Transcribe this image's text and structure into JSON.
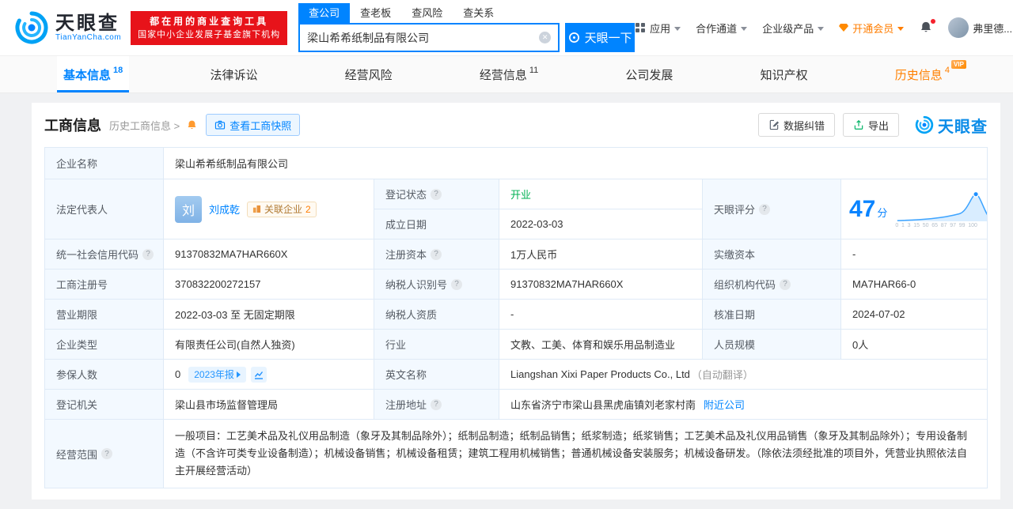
{
  "colors": {
    "brand_blue": "#0084ff",
    "vip_orange": "#ff7d00",
    "status_open_green": "#00b153",
    "banner_red": "#e7131a",
    "label_cell_bg": "#f3f9ff"
  },
  "icons": [
    "tianyancha-logo-icon",
    "clear-search-icon",
    "eye-icon",
    "apps-grid-icon",
    "vip-gem-icon",
    "notification-bell-icon",
    "chevron-down-icon",
    "help-icon",
    "reminder-bell-icon",
    "camera-icon",
    "data-correction-icon",
    "export-icon",
    "watermark-logo-icon",
    "related-company-icon",
    "annual-report-chart-icon",
    "score-distribution-chart"
  ],
  "header": {
    "logo": {
      "brand": "天眼查",
      "domain": "TianYanCha.com"
    },
    "slogan": {
      "line1": "都在用的商业查询工具",
      "line2": "国家中小企业发展子基金旗下机构"
    },
    "search_tabs": [
      {
        "label": "查公司"
      },
      {
        "label": "查老板"
      },
      {
        "label": "查风险"
      },
      {
        "label": "查关系"
      }
    ],
    "search": {
      "value": "梁山希希纸制品有限公司",
      "button_label": "天眼一下"
    },
    "menu": {
      "apps": "应用",
      "cooperation": "合作通道",
      "enterprise": "企业级产品",
      "vip": "开通会员",
      "user": "弗里德..."
    }
  },
  "nav": {
    "tabs": [
      {
        "label": "基本信息",
        "count": "18"
      },
      {
        "label": "法律诉讼"
      },
      {
        "label": "经营风险"
      },
      {
        "label": "经营信息",
        "count": "11"
      },
      {
        "label": "公司发展"
      },
      {
        "label": "知识产权"
      },
      {
        "label": "历史信息",
        "count": "4",
        "tag": "VIP"
      }
    ]
  },
  "toolbar": {
    "title": "工商信息",
    "history_link": "历史工商信息 >",
    "snapshot_button": "查看工商快照",
    "correct_button": "数据纠错",
    "export_button": "导出",
    "watermark": "天眼查"
  },
  "fields": {
    "company_name": {
      "label": "企业名称",
      "value": "梁山希希纸制品有限公司"
    },
    "legal_rep": {
      "label": "法定代表人",
      "avatar_char": "刘",
      "name": "刘成乾",
      "badge_label": "关联企业",
      "badge_count": "2"
    },
    "reg_status": {
      "label": "登记状态",
      "value": "开业"
    },
    "establish_date": {
      "label": "成立日期",
      "value": "2022-03-03"
    },
    "score": {
      "label": "天眼评分",
      "value": "47",
      "unit": "分",
      "ticks": [
        "0",
        "1",
        "3",
        "15",
        "50",
        "65",
        "87",
        "97",
        "99",
        "100"
      ]
    },
    "credit_code": {
      "label": "统一社会信用代码",
      "value": "91370832MA7HAR660X"
    },
    "reg_capital": {
      "label": "注册资本",
      "value": "1万人民币"
    },
    "paid_capital": {
      "label": "实缴资本",
      "value": "-"
    },
    "reg_number": {
      "label": "工商注册号",
      "value": "370832200272157"
    },
    "taxpayer_id": {
      "label": "纳税人识别号",
      "value": "91370832MA7HAR660X"
    },
    "org_code": {
      "label": "组织机构代码",
      "value": "MA7HAR66-0"
    },
    "business_term": {
      "label": "营业期限",
      "value": "2022-03-03 至 无固定期限"
    },
    "taxpayer_quality": {
      "label": "纳税人资质",
      "value": "-"
    },
    "approve_date": {
      "label": "核准日期",
      "value": "2024-07-02"
    },
    "company_type": {
      "label": "企业类型",
      "value": "有限责任公司(自然人独资)"
    },
    "industry": {
      "label": "行业",
      "value": "文教、工美、体育和娱乐用品制造业"
    },
    "staff_size": {
      "label": "人员规模",
      "value": "0人"
    },
    "insured": {
      "label": "参保人数",
      "value": "0",
      "report_badge": "2023年报"
    },
    "english_name": {
      "label": "英文名称",
      "value": "Liangshan Xixi Paper Products Co., Ltd",
      "note": "（自动翻译）"
    },
    "reg_authority": {
      "label": "登记机关",
      "value": "梁山县市场监督管理局"
    },
    "reg_address": {
      "label": "注册地址",
      "value": "山东省济宁市梁山县黑虎庙镇刘老家村南",
      "nearby_link": "附近公司"
    },
    "business_scope": {
      "label": "经营范围",
      "value": "一般项目：工艺美术品及礼仪用品制造（象牙及其制品除外）；纸制品制造；纸制品销售；纸浆制造；纸浆销售；工艺美术品及礼仪用品销售（象牙及其制品除外）；专用设备制造（不含许可类专业设备制造）；机械设备销售；机械设备租赁；建筑工程用机械销售；普通机械设备安装服务；机械设备研发。（除依法须经批准的项目外，凭营业执照依法自主开展经营活动）"
    }
  }
}
